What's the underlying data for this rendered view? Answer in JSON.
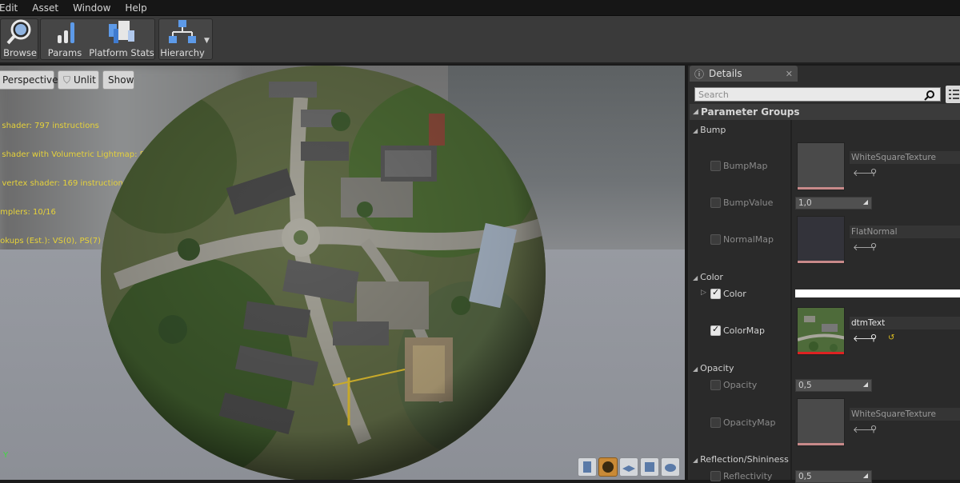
{
  "menu": [
    "Edit",
    "Asset",
    "Window",
    "Help"
  ],
  "toolbar": {
    "browse": "Browse",
    "params": "Params",
    "platform_stats": "Platform Stats",
    "hierarchy": "Hierarchy"
  },
  "viewport": {
    "perspective": "Perspective",
    "unlit": "Unlit",
    "show": "Show",
    "stats": [
      "s shader: 797 instructions",
      "s shader with Volumetric Lightmap: 868 instructions",
      "s vertex shader: 169 instructions",
      "amplers: 10/16",
      "ookups (Est.): VS(0), PS(7)"
    ],
    "axis_label": "Y"
  },
  "details": {
    "tab": "Details",
    "search_placeholder": "Search",
    "header": "Parameter Groups",
    "categories": {
      "bump": "Bump",
      "color": "Color",
      "opacity": "Opacity",
      "reflection": "Reflection/Shininess"
    },
    "params": {
      "bumpmap": "BumpMap",
      "bumpmap_tex": "WhiteSquareTexture",
      "bumpvalue": "BumpValue",
      "bumpvalue_val": "1,0",
      "normalmap": "NormalMap",
      "normalmap_tex": "FlatNormal",
      "color": "Color",
      "colormap": "ColorMap",
      "colormap_tex": "dtmText",
      "opacity": "Opacity",
      "opacity_val": "0,5",
      "opacitymap": "OpacityMap",
      "opacitymap_tex": "WhiteSquareTexture",
      "reflectivity": "Reflectivity",
      "reflectivity_val": "0,5"
    }
  }
}
